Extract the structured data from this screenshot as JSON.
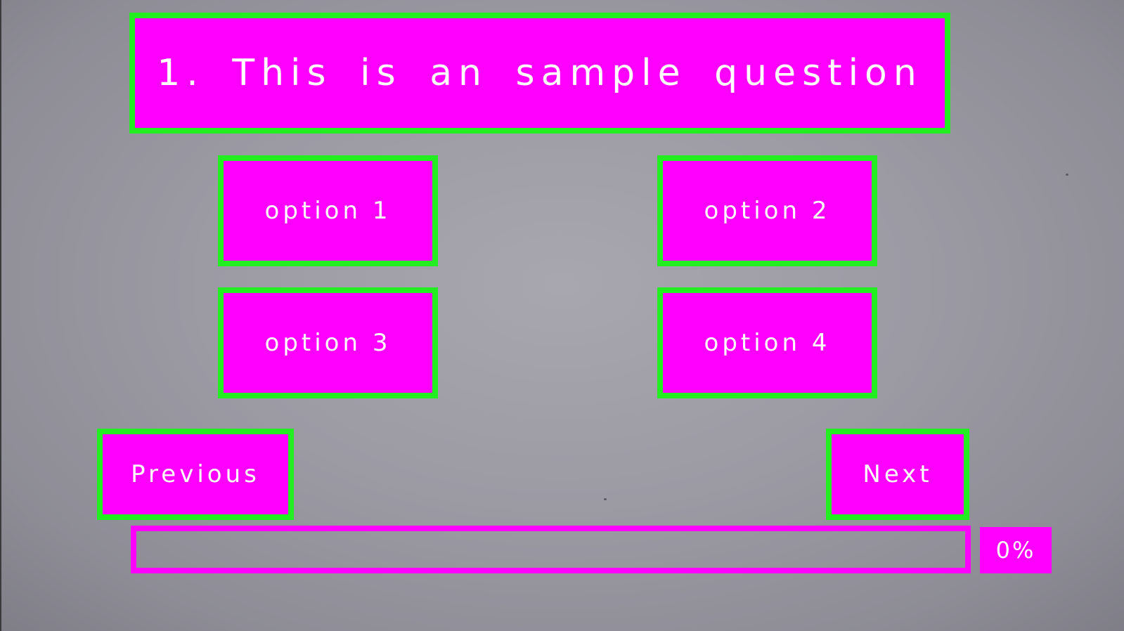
{
  "colors": {
    "magenta": "#ff00ff",
    "green": "#22ee22"
  },
  "question": {
    "text": "1. This is an sample question"
  },
  "options": [
    {
      "label": "option 1"
    },
    {
      "label": "option 2"
    },
    {
      "label": "option 3"
    },
    {
      "label": "option 4"
    }
  ],
  "navigation": {
    "previous_label": "Previous",
    "next_label": "Next"
  },
  "progress": {
    "value_fraction": 0,
    "label": "0%"
  }
}
